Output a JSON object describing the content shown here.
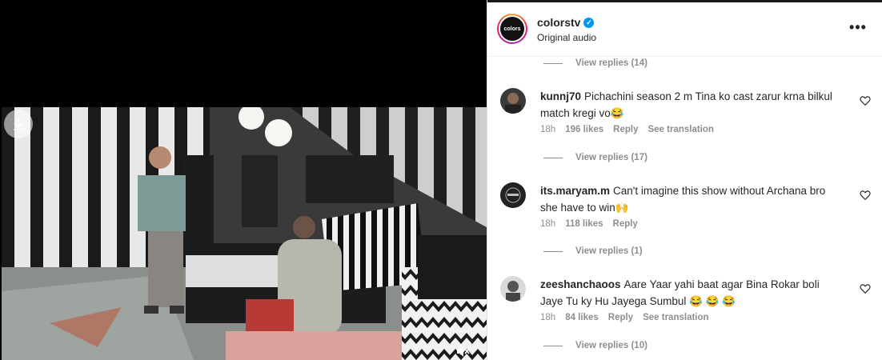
{
  "post": {
    "username": "colorstv",
    "verified": true,
    "subtitle": "Original audio",
    "avatar_text": "colors",
    "more_label": "•••"
  },
  "replies": {
    "r0": "View replies (14)",
    "r1": "View replies (17)",
    "r2": "View replies (1)",
    "r3": "View replies (10)"
  },
  "comments": [
    {
      "user": "kunnj70",
      "text": "Pichachini season 2 m Tina ko cast zarur krna bilkul match kregi vo😂",
      "time": "18h",
      "likes": "196 likes",
      "reply": "Reply",
      "translate": "See translation"
    },
    {
      "user": "its.maryam.m",
      "text": "Can't imagine this show without Archana bro she have to win🙌",
      "time": "18h",
      "likes": "118 likes",
      "reply": "Reply",
      "translate": ""
    },
    {
      "user": "zeeshanchaoos",
      "text": "Aare Yaar yahi baat agar Bina Rokar boli Jaye Tu ky Hu Jayega Sumbul 😂 😂 😂",
      "time": "18h",
      "likes": "84 likes",
      "reply": "Reply",
      "translate": "See translation"
    }
  ],
  "colors": {
    "accent_verified": "#0095f6",
    "muted_text": "#8e8e8e",
    "primary_text": "#262626"
  }
}
